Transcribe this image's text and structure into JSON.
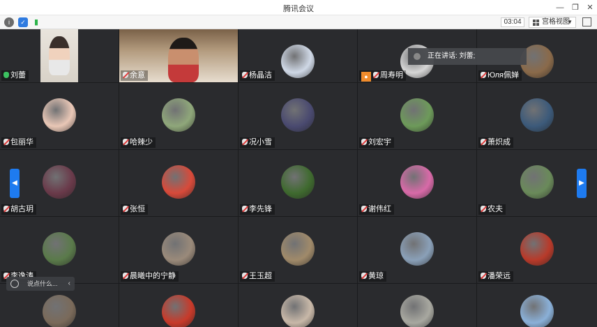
{
  "window": {
    "title": "腾讯会议"
  },
  "toolbar": {
    "timer": "03:04",
    "view_label": "宫格视图"
  },
  "speaking": {
    "text": "正在讲话: 刘蕾;"
  },
  "chat": {
    "placeholder": "说点什么..."
  },
  "participants": [
    {
      "name": "刘蕾",
      "mic": "on",
      "video": true,
      "bg": "#5a5f55"
    },
    {
      "name": "余意",
      "mic": "muted",
      "video": true,
      "bg": "#7a6148"
    },
    {
      "name": "杨晶洁",
      "mic": "muted",
      "bg": "#cfd8e6"
    },
    {
      "name": "周寿明",
      "mic": "muted",
      "host": true,
      "bg": "#d6d6d6"
    },
    {
      "name": "Юля佩婵",
      "mic": "muted",
      "bg": "#8a6a4a"
    },
    {
      "name": "包丽华",
      "mic": "muted",
      "bg": "#e9c7b6"
    },
    {
      "name": "哈辣少",
      "mic": "muted",
      "bg": "#8fa77a"
    },
    {
      "name": "况小雪",
      "mic": "muted",
      "bg": "#4a4a70"
    },
    {
      "name": "刘宏宇",
      "mic": "muted",
      "bg": "#6d9a5a"
    },
    {
      "name": "萧炽成",
      "mic": "muted",
      "bg": "#3c5a7a"
    },
    {
      "name": "胡古玥",
      "mic": "muted",
      "bg": "#6a3a4a"
    },
    {
      "name": "张恒",
      "mic": "muted",
      "bg": "#d84a3a"
    },
    {
      "name": "李先锋",
      "mic": "muted",
      "bg": "#3f6a2f"
    },
    {
      "name": "谢伟红",
      "mic": "muted",
      "bg": "#d86aa8"
    },
    {
      "name": "农夫",
      "mic": "muted",
      "bg": "#6a8a5a"
    },
    {
      "name": "李逸涛",
      "mic": "muted",
      "bg": "#5a7a4a"
    },
    {
      "name": "晨曦中的宁静",
      "mic": "muted",
      "bg": "#9a8a7a"
    },
    {
      "name": "王玉超",
      "mic": "muted",
      "bg": "#a08a6a"
    },
    {
      "name": "黄琼",
      "mic": "muted",
      "bg": "#8aa0b8"
    },
    {
      "name": "潘荣远",
      "mic": "muted",
      "bg": "#b83a2a"
    },
    {
      "name": "",
      "mic": "none",
      "bg": "#7a6a5a"
    },
    {
      "name": "",
      "mic": "none",
      "bg": "#c83a2a"
    },
    {
      "name": "",
      "mic": "none",
      "bg": "#c8b8a8"
    },
    {
      "name": "",
      "mic": "none",
      "bg": "#a8a8a0"
    },
    {
      "name": "",
      "mic": "none",
      "bg": "#8ab0d8"
    }
  ]
}
